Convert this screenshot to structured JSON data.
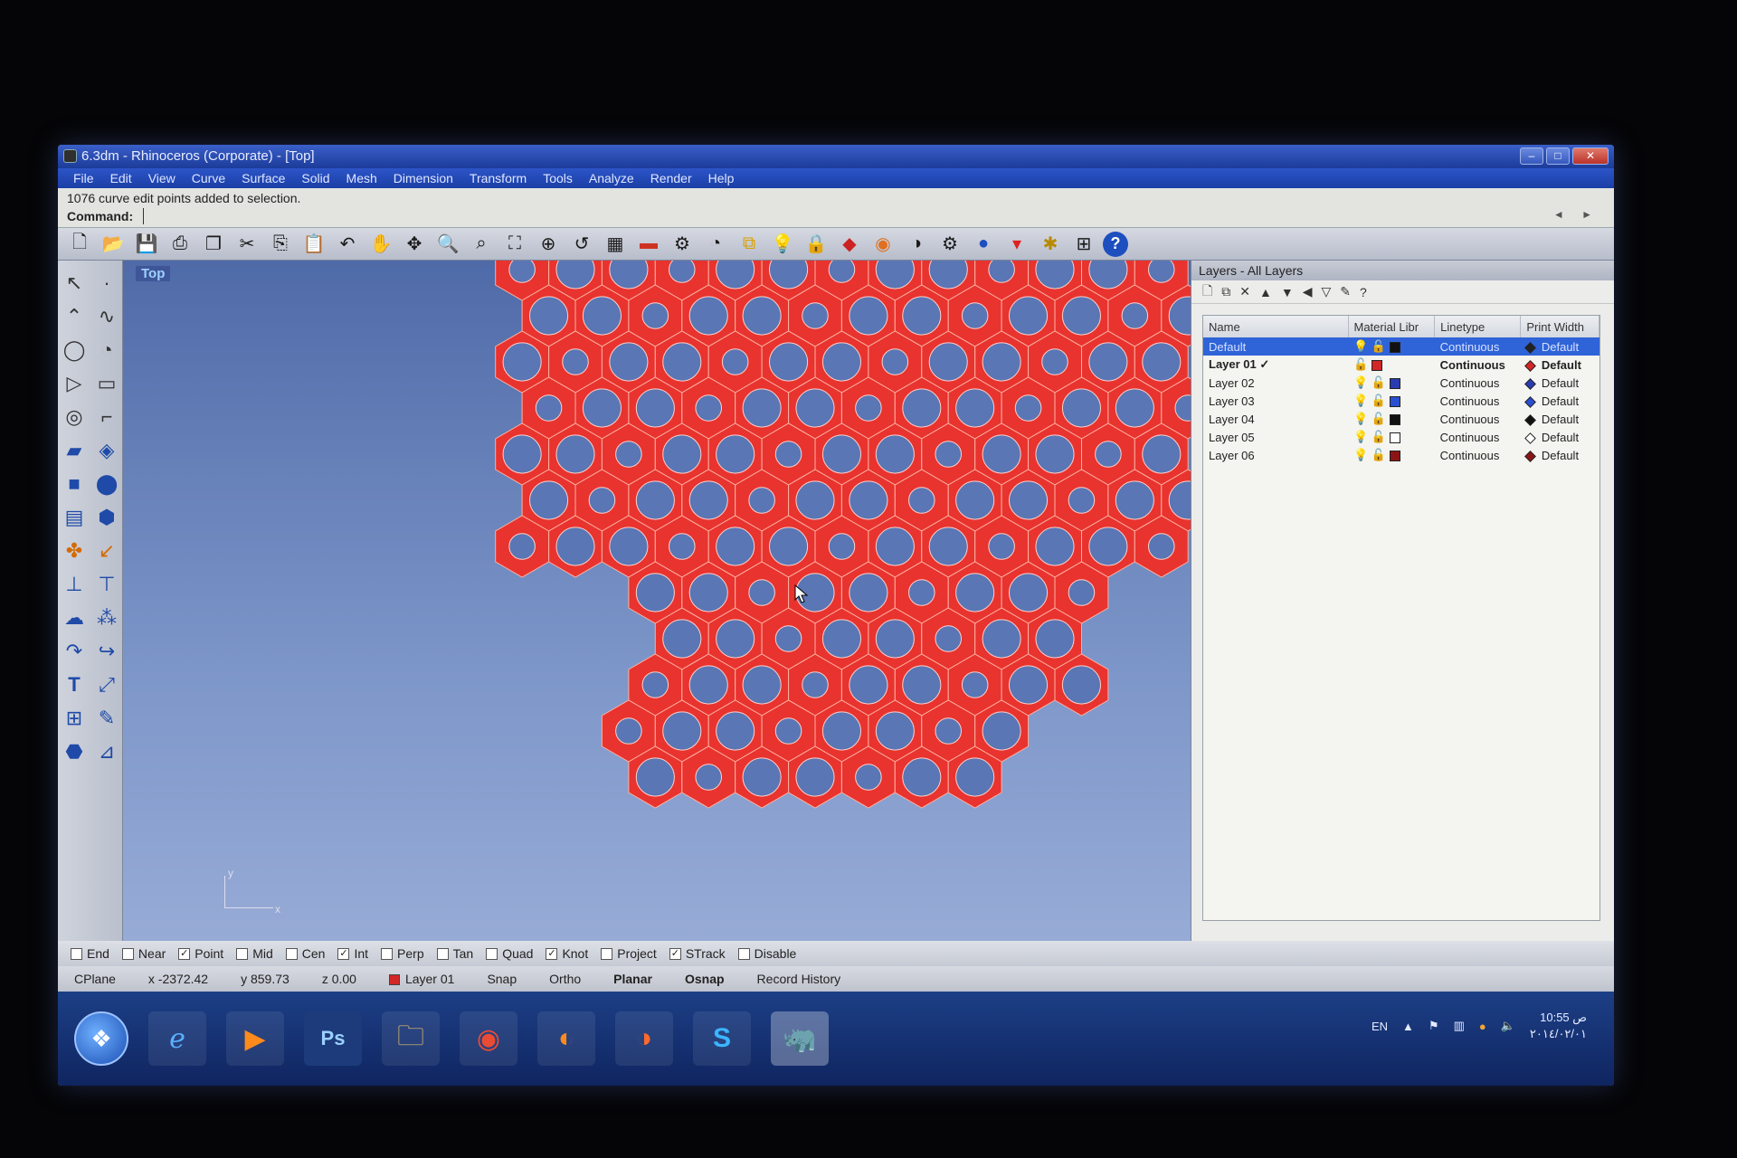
{
  "window": {
    "title": "6.3dm - Rhinoceros (Corporate) - [Top]"
  },
  "menu": [
    "File",
    "Edit",
    "View",
    "Curve",
    "Surface",
    "Solid",
    "Mesh",
    "Dimension",
    "Transform",
    "Tools",
    "Analyze",
    "Render",
    "Help"
  ],
  "command": {
    "history": "1076 curve edit points added to selection.",
    "prompt_label": "Command:",
    "input_value": ""
  },
  "toolbar_icons": [
    "new-file",
    "open-folder",
    "save",
    "print",
    "copy-to-clipboard",
    "cut",
    "copy",
    "paste",
    "undo",
    "pan-hand",
    "rotate-view",
    "zoom",
    "zoom-window",
    "zoom-extents",
    "zoom-selected",
    "undo-view",
    "grid",
    "osnap",
    "named-views",
    "cplane",
    "layer",
    "light-bulb",
    "lock",
    "render-material",
    "color",
    "shaded",
    "render-preview",
    "rendered",
    "properties",
    "settings",
    "display-options",
    "help"
  ],
  "viewport": {
    "title": "Top",
    "axis_y": "y",
    "axis_x": "x"
  },
  "layers_panel": {
    "title": "Layers - All Layers",
    "columns": [
      "Name",
      "Material Libr",
      "Linetype",
      "Print Width"
    ],
    "rows": [
      {
        "name": "Default",
        "current": false,
        "visible_icon": "bulb",
        "color": "#111111",
        "linetype": "Continuous",
        "print_color": "#222222",
        "print_width": "Default",
        "selected": true
      },
      {
        "name": "Layer 01",
        "current": true,
        "check": "✓",
        "visible_icon": "none",
        "color": "#d32626",
        "linetype": "Continuous",
        "print_color": "#d32626",
        "print_width": "Default",
        "selected": false
      },
      {
        "name": "Layer 02",
        "current": false,
        "visible_icon": "bulb",
        "color": "#2a3cb0",
        "linetype": "Continuous",
        "print_color": "#2a3cb0",
        "print_width": "Default",
        "selected": false
      },
      {
        "name": "Layer 03",
        "current": false,
        "visible_icon": "bulb",
        "color": "#2a4fd0",
        "linetype": "Continuous",
        "print_color": "#2a4fd0",
        "print_width": "Default",
        "selected": false
      },
      {
        "name": "Layer 04",
        "current": false,
        "visible_icon": "bulb",
        "color": "#111111",
        "linetype": "Continuous",
        "print_color": "#111111",
        "print_width": "Default",
        "selected": false
      },
      {
        "name": "Layer 05",
        "current": false,
        "visible_icon": "bulb-blue",
        "color": "#ffffff",
        "linetype": "Continuous",
        "print_color": "#ffffff",
        "print_width": "Default",
        "selected": false
      },
      {
        "name": "Layer 06",
        "current": false,
        "visible_icon": "bulb-blue",
        "color": "#8b1515",
        "linetype": "Continuous",
        "print_color": "#8b1515",
        "print_width": "Default",
        "selected": false
      }
    ]
  },
  "osnap": [
    {
      "label": "End",
      "checked": false
    },
    {
      "label": "Near",
      "checked": false
    },
    {
      "label": "Point",
      "checked": true
    },
    {
      "label": "Mid",
      "checked": false
    },
    {
      "label": "Cen",
      "checked": false
    },
    {
      "label": "Int",
      "checked": true
    },
    {
      "label": "Perp",
      "checked": false
    },
    {
      "label": "Tan",
      "checked": false
    },
    {
      "label": "Quad",
      "checked": false
    },
    {
      "label": "Knot",
      "checked": true
    },
    {
      "label": "Project",
      "checked": false
    },
    {
      "label": "STrack",
      "checked": true
    },
    {
      "label": "Disable",
      "checked": false
    }
  ],
  "status": {
    "cplane": "CPlane",
    "x": "x -2372.42",
    "y": "y 859.73",
    "z": "z 0.00",
    "layer": "Layer 01",
    "snap": "Snap",
    "ortho": "Ortho",
    "planar": "Planar",
    "osnap": "Osnap",
    "record_history": "Record History"
  },
  "taskbar": {
    "apps": [
      "internet-explorer",
      "media-player",
      "photoshop",
      "file-explorer",
      "chrome",
      "firefox",
      "firefox-alt",
      "skype",
      "rhino"
    ],
    "tray_lang": "EN",
    "clock_time": "10:55 ص",
    "clock_date": "٢٠١٤/٠٢/٠١"
  },
  "colors": {
    "accent": "#2f63d8",
    "hex_pattern": "#e8332f",
    "viewport_top": "#4f6aa8",
    "viewport_bottom": "#97abd6"
  }
}
